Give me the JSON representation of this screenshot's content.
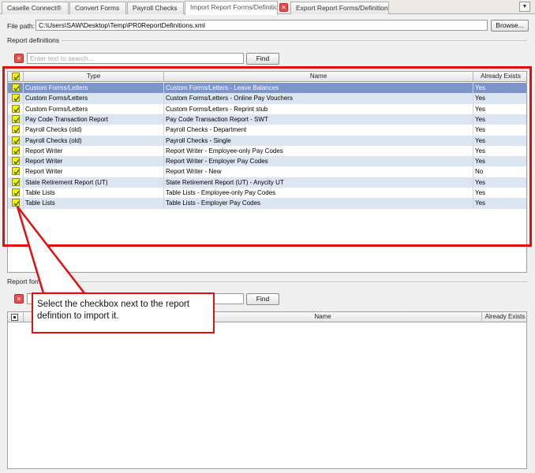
{
  "tabs": [
    {
      "label": "Caselle Connect®",
      "active": false
    },
    {
      "label": "Convert Forms",
      "active": false
    },
    {
      "label": "Payroll Checks",
      "active": false
    },
    {
      "label": "Import Report Forms/Definitions",
      "active": true
    },
    {
      "label": "Export Report Forms/Definitions",
      "active": false
    }
  ],
  "tab_close_glyph": "×",
  "tab_menu_glyph": "▼",
  "file_path": {
    "label": "File path:",
    "value": "C:\\Users\\SAW\\Desktop\\Temp\\PR0ReportDefinitions.xml",
    "browse_label": "Browse..."
  },
  "report_definitions": {
    "section_title": "Report definitions",
    "search_placeholder": "Enter text to search...",
    "find_label": "Find",
    "columns": {
      "type": "Type",
      "name": "Name",
      "exists": "Already Exists"
    },
    "rows": [
      {
        "type": "Custom Forms/Letters",
        "name": "Custom Forms/Letters - Leave Balances",
        "exists": "Yes",
        "checked": true
      },
      {
        "type": "Custom Forms/Letters",
        "name": "Custom Forms/Letters - Online Pay Vouchers",
        "exists": "Yes",
        "checked": true
      },
      {
        "type": "Custom Forms/Letters",
        "name": "Custom Forms/Letters - Reprint stub",
        "exists": "Yes",
        "checked": true
      },
      {
        "type": "Pay Code Transaction Report",
        "name": "Pay Code Transaction Report - SWT",
        "exists": "Yes",
        "checked": true
      },
      {
        "type": "Payroll Checks (old)",
        "name": "Payroll Checks - Department",
        "exists": "Yes",
        "checked": true
      },
      {
        "type": "Payroll Checks (old)",
        "name": "Payroll Checks - Single",
        "exists": "Yes",
        "checked": true
      },
      {
        "type": "Report Writer",
        "name": "Report Writer - Employee-only Pay Codes",
        "exists": "Yes",
        "checked": true
      },
      {
        "type": "Report Writer",
        "name": "Report Writer - Employer Pay Codes",
        "exists": "Yes",
        "checked": true
      },
      {
        "type": "Report Writer",
        "name": "Report Writer - New",
        "exists": "No",
        "checked": true
      },
      {
        "type": "State Retirement Report (UT)",
        "name": "State Retirement Report (UT) - Anycity UT",
        "exists": "Yes",
        "checked": true
      },
      {
        "type": "Table Lists",
        "name": "Table Lists - Employee-only Pay Codes",
        "exists": "Yes",
        "checked": true
      },
      {
        "type": "Table Lists",
        "name": "Table Lists - Employer Pay Codes",
        "exists": "Yes",
        "checked": true
      }
    ]
  },
  "report_forms": {
    "section_title": "Report forms",
    "find_label": "Find",
    "columns": {
      "name": "Name",
      "exists": "Already Exists"
    }
  },
  "callout": {
    "text": "Select the checkbox next to the report defintion to import it."
  },
  "colors": {
    "annotation_red": "#e01010",
    "checkbox_highlight": "#f5f100",
    "selected_row": "#7d95c8",
    "alternate_row": "#dce5f2"
  }
}
